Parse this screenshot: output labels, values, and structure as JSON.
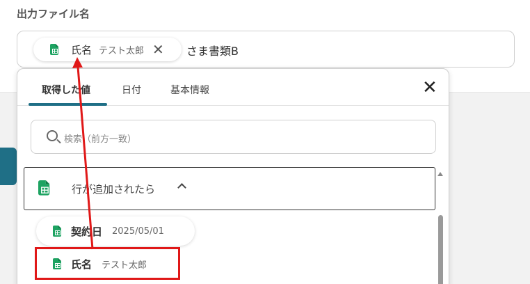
{
  "field": {
    "label": "出力ファイル名",
    "chip": {
      "name": "氏名",
      "value": "テスト太郎",
      "close": "✕"
    },
    "after_text": "さま書類B"
  },
  "panel": {
    "tabs": [
      {
        "label": "取得した値",
        "active": true
      },
      {
        "label": "日付",
        "active": false
      },
      {
        "label": "基本情報",
        "active": false
      }
    ],
    "close": "✕",
    "search": {
      "placeholder": "検索（前方一致）"
    },
    "group": {
      "label": "行が追加されたら",
      "expanded": true
    },
    "items": [
      {
        "name": "契約日",
        "value": "2025/05/01"
      },
      {
        "name": "氏名",
        "value": "テスト太郎"
      }
    ]
  },
  "annotation": {
    "color": "#e01818",
    "icon": "spreadsheet-icon"
  },
  "colors": {
    "accent": "#1f6f86",
    "sheet_green": "#1ea362"
  }
}
